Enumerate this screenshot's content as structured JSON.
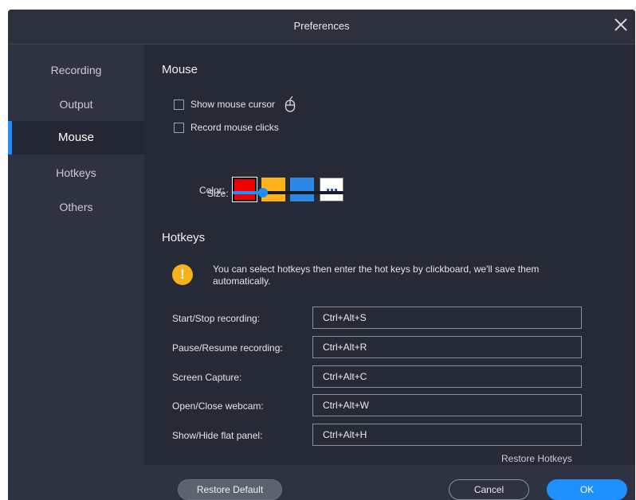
{
  "window": {
    "title": "Preferences"
  },
  "sidebar": {
    "items": [
      {
        "label": "Recording"
      },
      {
        "label": "Output"
      },
      {
        "label": "Mouse",
        "active": true
      },
      {
        "label": "Hotkeys"
      },
      {
        "label": "Others"
      }
    ]
  },
  "mouse": {
    "heading": "Mouse",
    "show_cursor": {
      "label": "Show mouse cursor",
      "checked": false
    },
    "record_clicks": {
      "label": "Record mouse clicks",
      "checked": false
    },
    "color_label": "Color:",
    "colors": [
      "#ee0000",
      "#ffb21a",
      "#2d87e6"
    ],
    "selected_color": "#ee0000",
    "size_label": "Size:",
    "size_value": 0.27
  },
  "hotkeys": {
    "heading": "Hotkeys",
    "info": "You can select hotkeys then enter the hot keys by clickboard, we'll save them automatically.",
    "rows": [
      {
        "label": "Start/Stop recording:",
        "value": "Ctrl+Alt+S"
      },
      {
        "label": "Pause/Resume recording:",
        "value": "Ctrl+Alt+R"
      },
      {
        "label": "Screen Capture:",
        "value": "Ctrl+Alt+C"
      },
      {
        "label": "Open/Close webcam:",
        "value": "Ctrl+Alt+W"
      },
      {
        "label": "Show/Hide flat panel:",
        "value": "Ctrl+Alt+H"
      }
    ],
    "restore_label": "Restore Hotkeys"
  },
  "footer": {
    "restore_default": "Restore Default",
    "cancel": "Cancel",
    "ok": "OK"
  },
  "theme": {
    "accent": "#1e8fff",
    "background": "#262a36",
    "sidebar": "#2f3341"
  }
}
